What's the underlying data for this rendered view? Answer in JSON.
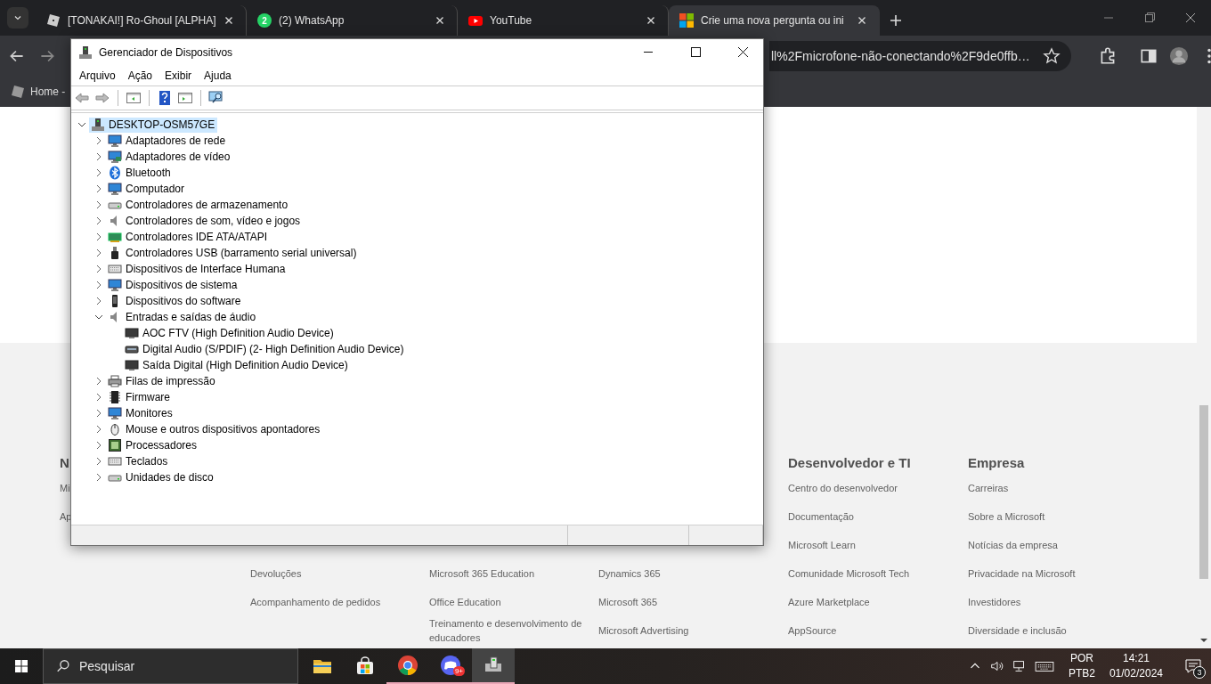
{
  "browser": {
    "tabs": [
      {
        "title": "[TONAKAI!] Ro-Ghoul [ALPHA]",
        "selected": false
      },
      {
        "title": "(2) WhatsApp",
        "icon_badge": "2",
        "selected": false
      },
      {
        "title": "YouTube",
        "selected": false
      },
      {
        "title": "Crie uma nova pergunta ou ini",
        "selected": true
      }
    ],
    "address": "ll%2Fmicrofone-não-conectando%2F9de0ffb…",
    "bookmarks": [
      "Home -"
    ]
  },
  "page": {
    "footer_columns": [
      {
        "heading": "N",
        "links": [
          "Mi",
          "Ap"
        ]
      },
      {
        "links": [
          "Devoluções",
          "Acompanhamento de pedidos"
        ]
      },
      {
        "links": [
          "Microsoft 365 Education",
          "Office Education",
          "Treinamento e desenvolvimento de educadores"
        ]
      },
      {
        "links": [
          "Dynamics 365",
          "Microsoft 365",
          "Microsoft Advertising"
        ]
      },
      {
        "heading": "Desenvolvedor e TI",
        "links": [
          "Centro do desenvolvedor",
          "Documentação",
          "Microsoft Learn",
          "Comunidade Microsoft Tech",
          "Azure Marketplace",
          "AppSource"
        ]
      },
      {
        "heading": "Empresa",
        "links": [
          "Carreiras",
          "Sobre a Microsoft",
          "Notícias da empresa",
          "Privacidade na Microsoft",
          "Investidores",
          "Diversidade e inclusão"
        ]
      }
    ]
  },
  "device_manager": {
    "title": "Gerenciador de Dispositivos",
    "menu": [
      "Arquivo",
      "Ação",
      "Exibir",
      "Ajuda"
    ],
    "tree": {
      "label": "DESKTOP-OSM57GE",
      "expanded": true,
      "selected": true,
      "children": [
        {
          "label": "Adaptadores de rede",
          "expanded": false,
          "selected": false
        },
        {
          "label": "Adaptadores de vídeo",
          "expanded": false,
          "selected": false
        },
        {
          "label": "Bluetooth",
          "expanded": false,
          "selected": false
        },
        {
          "label": "Computador",
          "expanded": false,
          "selected": false
        },
        {
          "label": "Controladores de armazenamento",
          "expanded": false,
          "selected": false
        },
        {
          "label": "Controladores de som, vídeo e jogos",
          "expanded": false,
          "selected": false
        },
        {
          "label": "Controladores IDE ATA/ATAPI",
          "expanded": false,
          "selected": false
        },
        {
          "label": "Controladores USB (barramento serial universal)",
          "expanded": false,
          "selected": false
        },
        {
          "label": "Dispositivos de Interface Humana",
          "expanded": false,
          "selected": false
        },
        {
          "label": "Dispositivos de sistema",
          "expanded": false,
          "selected": false
        },
        {
          "label": "Dispositivos do software",
          "expanded": false,
          "selected": false
        },
        {
          "label": "Entradas e saídas de áudio",
          "expanded": true,
          "selected": false,
          "children": [
            {
              "label": "AOC FTV (High Definition Audio Device)",
              "selected": false
            },
            {
              "label": "Digital Audio (S/PDIF) (2- High Definition Audio Device)",
              "selected": false
            },
            {
              "label": "Saída Digital (High Definition Audio Device)",
              "selected": false
            }
          ]
        },
        {
          "label": "Filas de impressão",
          "expanded": false,
          "selected": false
        },
        {
          "label": "Firmware",
          "expanded": false,
          "selected": false
        },
        {
          "label": "Monitores",
          "expanded": false,
          "selected": false
        },
        {
          "label": "Mouse e outros dispositivos apontadores",
          "expanded": false,
          "selected": false
        },
        {
          "label": "Processadores",
          "expanded": false,
          "selected": false
        },
        {
          "label": "Teclados",
          "expanded": false,
          "selected": false
        },
        {
          "label": "Unidades de disco",
          "expanded": false,
          "selected": false
        }
      ]
    }
  },
  "taskbar": {
    "search_placeholder": "Pesquisar",
    "apps": [
      {
        "running": false,
        "active": false
      },
      {
        "running": false,
        "active": false
      },
      {
        "running": true,
        "active": false
      },
      {
        "running": true,
        "active": false,
        "badge": "9+"
      },
      {
        "running": true,
        "active": true
      }
    ],
    "language": "POR",
    "layout": "PTB2",
    "time": "14:21",
    "date": "01/02/2024",
    "notifications": "3"
  }
}
